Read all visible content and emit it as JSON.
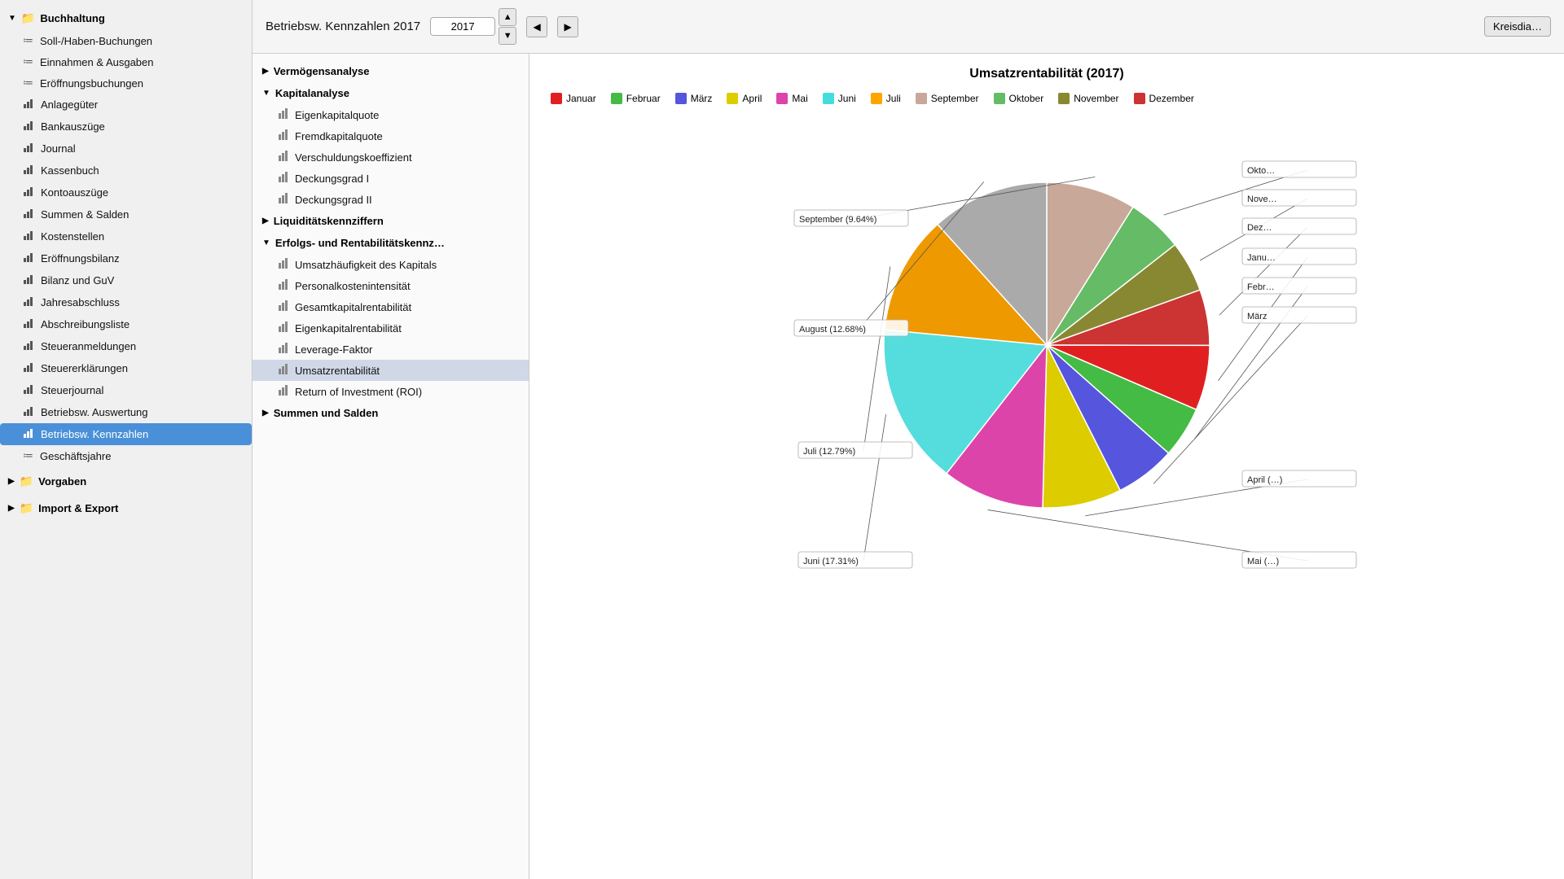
{
  "sidebar": {
    "groups": [
      {
        "id": "buchhaltung",
        "label": "Buchhaltung",
        "expanded": true,
        "items": [
          {
            "id": "soll-haben",
            "label": "Soll-/Haben-Buchungen",
            "icon": "≔"
          },
          {
            "id": "einnahmen",
            "label": "Einnahmen & Ausgaben",
            "icon": "≔"
          },
          {
            "id": "eroeffnung",
            "label": "Eröffnungsbuchungen",
            "icon": "≔"
          },
          {
            "id": "anlagegueter",
            "label": "Anlagegüter",
            "icon": "📈"
          },
          {
            "id": "bankauszuege",
            "label": "Bankauszüge",
            "icon": "📈"
          },
          {
            "id": "journal",
            "label": "Journal",
            "icon": "📈"
          },
          {
            "id": "kassenbuch",
            "label": "Kassenbuch",
            "icon": "📈"
          },
          {
            "id": "kontoauszuege",
            "label": "Kontoauszüge",
            "icon": "📈"
          },
          {
            "id": "summen-salden",
            "label": "Summen & Salden",
            "icon": "📈"
          },
          {
            "id": "kostenstellen",
            "label": "Kostenstellen",
            "icon": "📈"
          },
          {
            "id": "eroeffnungsbilanz",
            "label": "Eröffnungsbilanz",
            "icon": "📈"
          },
          {
            "id": "bilanz-guv",
            "label": "Bilanz und GuV",
            "icon": "📈"
          },
          {
            "id": "jahresabschluss",
            "label": "Jahresabschluss",
            "icon": "📈"
          },
          {
            "id": "abschreibungsliste",
            "label": "Abschreibungsliste",
            "icon": "📈"
          },
          {
            "id": "steueranmeldungen",
            "label": "Steueranmeldungen",
            "icon": "📈"
          },
          {
            "id": "steuererklaerungen",
            "label": "Steuererklärungen",
            "icon": "📈"
          },
          {
            "id": "steuerjournal",
            "label": "Steuerjournal",
            "icon": "📈"
          },
          {
            "id": "betriebsw-auswertung",
            "label": "Betriebsw. Auswertung",
            "icon": "📈"
          },
          {
            "id": "betriebsw-kennzahlen",
            "label": "Betriebsw. Kennzahlen",
            "icon": "📈",
            "active": true
          },
          {
            "id": "geschaeftsjahre",
            "label": "Geschäftsjahre",
            "icon": "≔"
          }
        ]
      },
      {
        "id": "vorgaben",
        "label": "Vorgaben",
        "expanded": false,
        "items": []
      },
      {
        "id": "import-export",
        "label": "Import & Export",
        "expanded": false,
        "items": []
      }
    ]
  },
  "header": {
    "title": "Betriebsw. Kennzahlen 2017",
    "year": "2017",
    "kreisdia_label": "Kreisdia…"
  },
  "tree": {
    "sections": [
      {
        "id": "vermoegens",
        "label": "Vermögensanalyse",
        "expanded": false,
        "items": []
      },
      {
        "id": "kapital",
        "label": "Kapitalanalyse",
        "expanded": true,
        "items": [
          {
            "id": "eigenkapitalquote",
            "label": "Eigenkapitalquote"
          },
          {
            "id": "fremdkapitalquote",
            "label": "Fremdkapitalquote"
          },
          {
            "id": "verschuldungskoeffizient",
            "label": "Verschuldungskoeffizient"
          },
          {
            "id": "deckungsgrad-i",
            "label": "Deckungsgrad I"
          },
          {
            "id": "deckungsgrad-ii",
            "label": "Deckungsgrad II"
          }
        ]
      },
      {
        "id": "liquiditaet",
        "label": "Liquiditätskennziffern",
        "expanded": false,
        "items": []
      },
      {
        "id": "erfolgs",
        "label": "Erfolgs- und Rentabilitätskennz…",
        "expanded": true,
        "items": [
          {
            "id": "umsatzhaeufigkeit",
            "label": "Umsatzhäufigkeit des Kapitals"
          },
          {
            "id": "personalkostenintensitaet",
            "label": "Personalkostenintensität"
          },
          {
            "id": "gesamtkapitalrentabilitaet",
            "label": "Gesamtkapitalrentabilität"
          },
          {
            "id": "eigenkapitalrentabilitaet",
            "label": "Eigenkapitalrentabilität"
          },
          {
            "id": "leverage-faktor",
            "label": "Leverage-Faktor"
          },
          {
            "id": "umsatzrentabilitaet",
            "label": "Umsatzrentabilität",
            "selected": true
          },
          {
            "id": "roi",
            "label": "Return of Investment (ROI)"
          }
        ]
      },
      {
        "id": "summen-salden",
        "label": "Summen und Salden",
        "expanded": false,
        "items": []
      }
    ]
  },
  "chart": {
    "title": "Umsatzrentabilität (2017)",
    "legend": [
      {
        "id": "januar",
        "label": "Januar",
        "color": "#e02020"
      },
      {
        "id": "februar",
        "label": "Februar",
        "color": "#44bb44"
      },
      {
        "id": "maerz",
        "label": "März",
        "color": "#5555dd"
      },
      {
        "id": "april",
        "label": "April",
        "color": "#ddcc00"
      },
      {
        "id": "mai",
        "label": "Mai",
        "color": "#dd44aa"
      },
      {
        "id": "juni",
        "label": "Juni",
        "color": "#44dddd"
      },
      {
        "id": "juli",
        "label": "Juli",
        "color": "orange"
      },
      {
        "id": "september",
        "label": "September",
        "color": "#c8a898"
      },
      {
        "id": "oktober",
        "label": "Oktober",
        "color": "#66bb66"
      },
      {
        "id": "november",
        "label": "November",
        "color": "#888833"
      },
      {
        "id": "dezember",
        "label": "Dezember",
        "color": "#cc3333"
      }
    ],
    "slices": [
      {
        "id": "september",
        "label": "September (9.64%)",
        "pct": 9.64,
        "color": "#c8a898",
        "labelX": -320,
        "labelY": -160
      },
      {
        "id": "oktober",
        "label": "Oktober",
        "pct": 6.0,
        "color": "#66bb66",
        "labelX": 280,
        "labelY": -220
      },
      {
        "id": "november",
        "label": "November",
        "pct": 5.5,
        "color": "#888833",
        "labelX": 280,
        "labelY": -180
      },
      {
        "id": "dezember",
        "label": "Dezember",
        "pct": 6.0,
        "color": "#cc3333",
        "labelX": 280,
        "labelY": -140
      },
      {
        "id": "januar",
        "label": "Januar",
        "pct": 7.0,
        "color": "#e02020",
        "labelX": 280,
        "labelY": -100
      },
      {
        "id": "februar",
        "label": "Februar",
        "pct": 5.5,
        "color": "#44bb44",
        "labelX": 280,
        "labelY": -60
      },
      {
        "id": "maerz",
        "label": "März",
        "pct": 6.5,
        "color": "#5555dd",
        "labelX": 280,
        "labelY": -20
      },
      {
        "id": "april",
        "label": "April ()",
        "pct": 8.5,
        "color": "#ddcc00",
        "labelX": 280,
        "labelY": 160
      },
      {
        "id": "mai",
        "label": "Mai ()",
        "pct": 11.0,
        "color": "#dd44aa",
        "labelX": 280,
        "labelY": 260
      },
      {
        "id": "juni",
        "label": "Juni (17.31%)",
        "pct": 17.31,
        "color": "#55dddd",
        "labelX": -300,
        "labelY": 260
      },
      {
        "id": "juli",
        "label": "Juli (12.79%)",
        "pct": 12.79,
        "color": "#ee9900",
        "labelX": -300,
        "labelY": 130
      },
      {
        "id": "august",
        "label": "August (12.68%)",
        "pct": 12.68,
        "color": "#aaaaaa",
        "labelX": -300,
        "labelY": -20
      }
    ]
  }
}
